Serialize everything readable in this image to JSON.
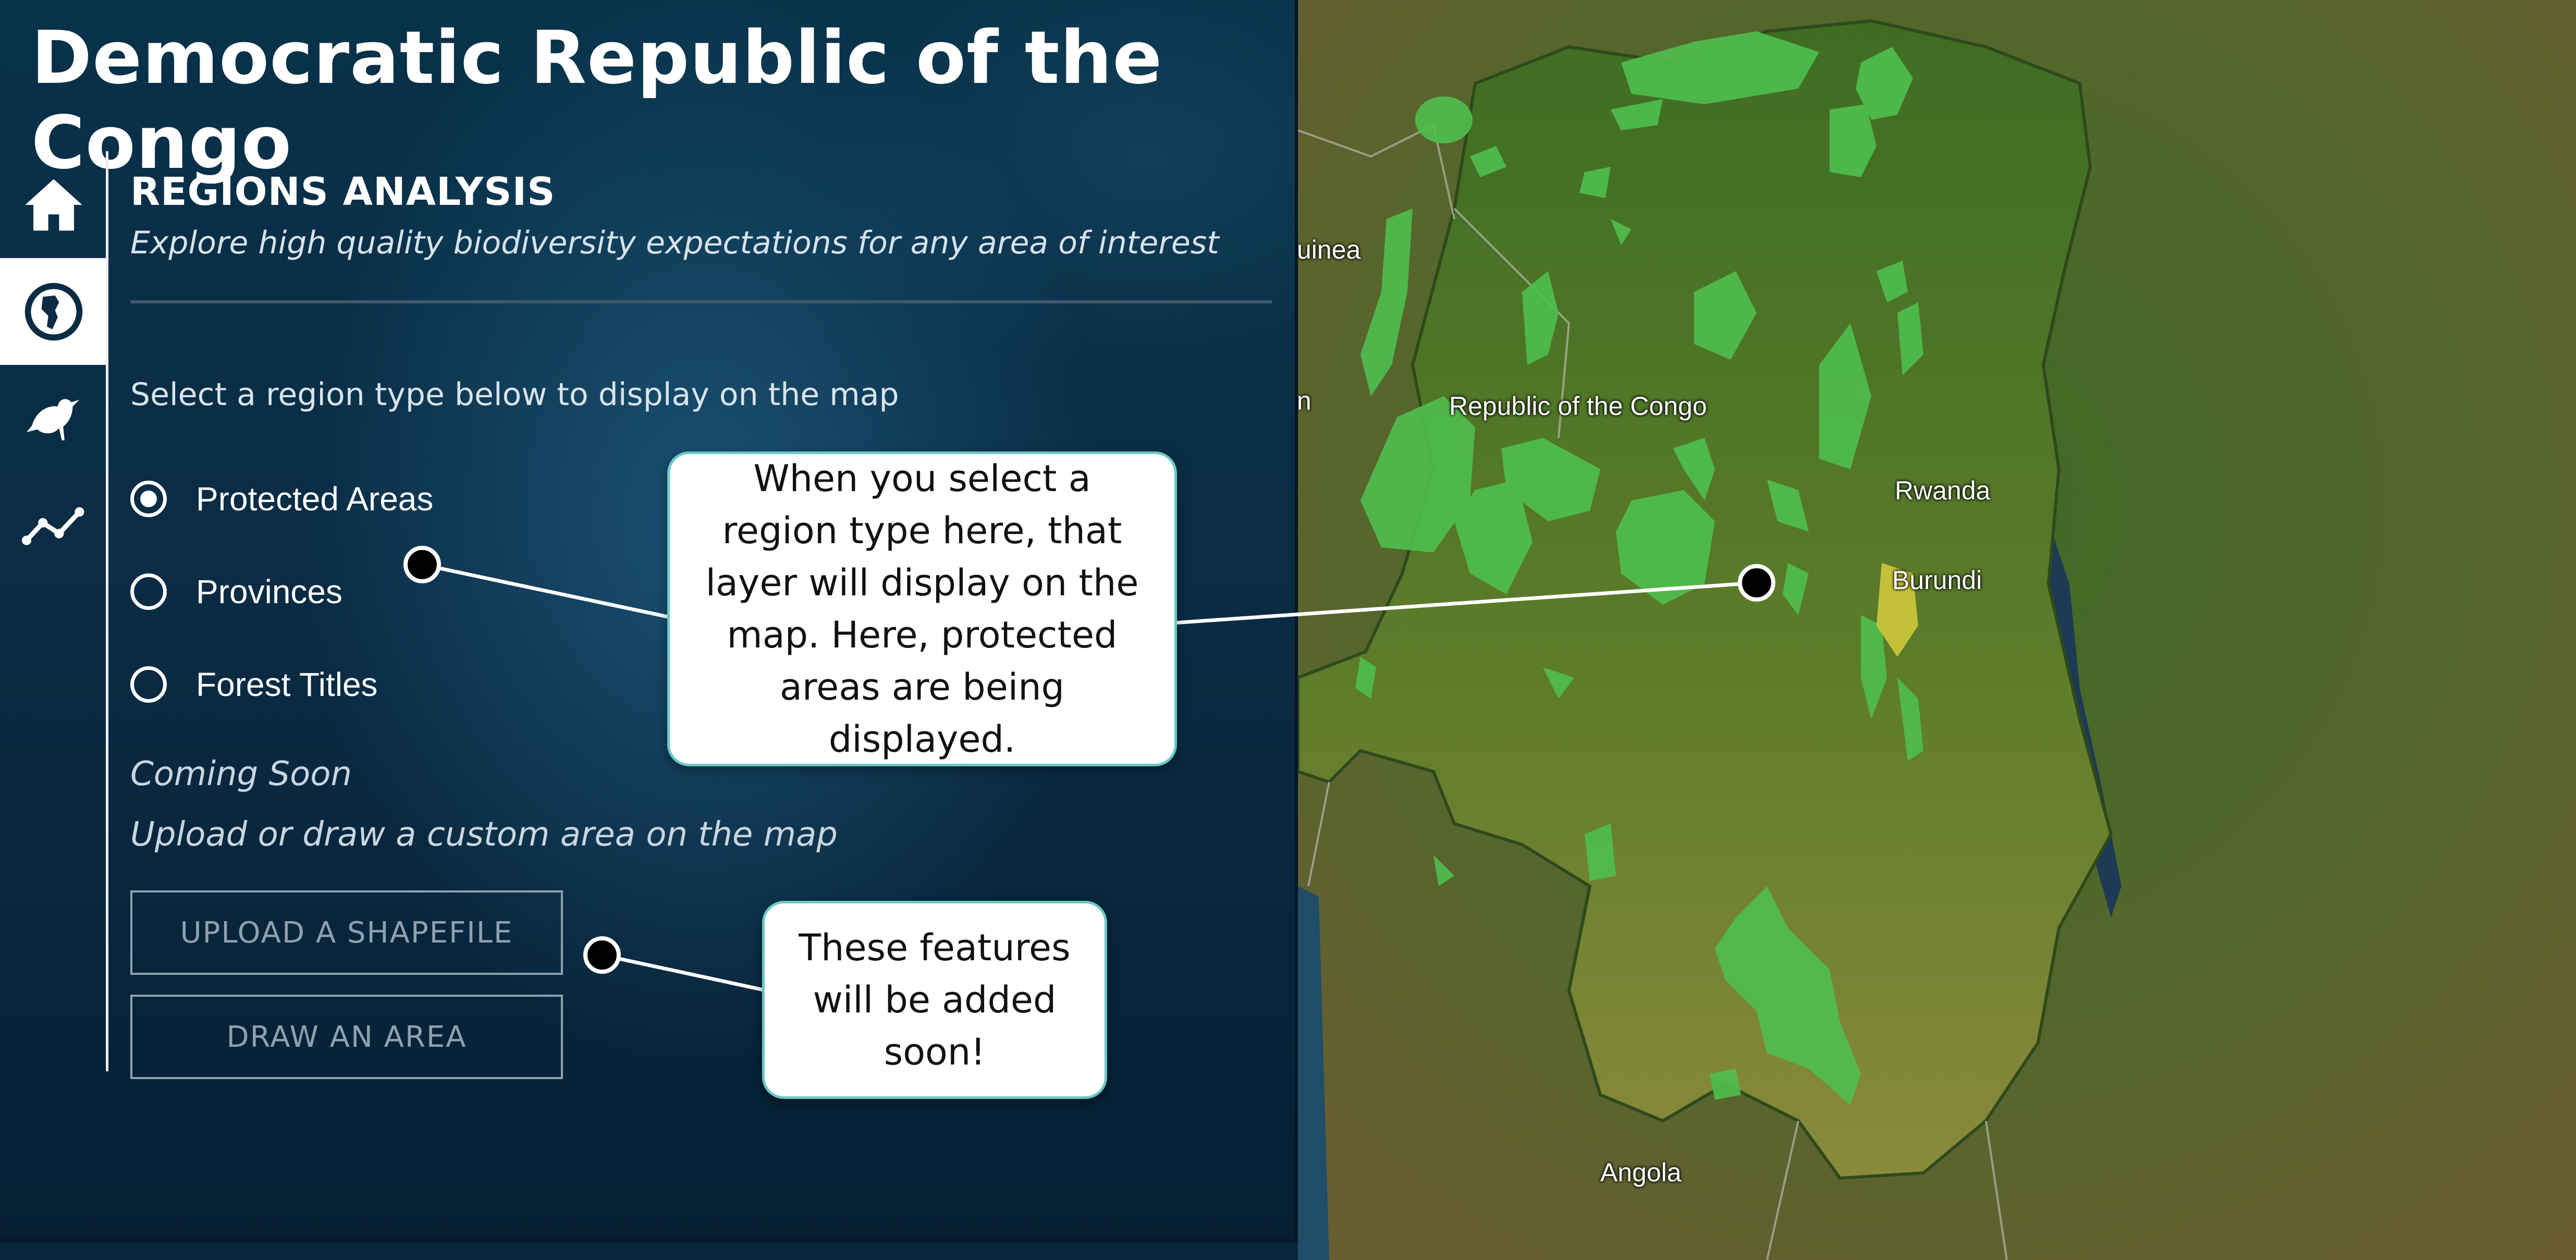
{
  "app": {
    "title": "Democratic Republic of the Congo"
  },
  "sidebar": {
    "items": [
      {
        "icon": "home-icon",
        "active": false
      },
      {
        "icon": "globe-region-icon",
        "active": true
      },
      {
        "icon": "bird-icon",
        "active": false
      },
      {
        "icon": "trend-line-icon",
        "active": false
      }
    ]
  },
  "regions": {
    "title": "REGIONS ANALYSIS",
    "subtitle": "Explore high quality biodiversity expectations for any area of interest",
    "instruction": "Select a region type below to display on the map",
    "options": [
      {
        "label": "Protected Areas",
        "selected": true
      },
      {
        "label": "Provinces",
        "selected": false
      },
      {
        "label": "Forest Titles",
        "selected": false
      }
    ],
    "coming_soon": "Coming Soon",
    "custom_area": "Upload or draw a custom area on the map",
    "upload_label": "UPLOAD A SHAPEFILE",
    "draw_label": "DRAW AN AREA"
  },
  "map": {
    "labels": {
      "guinea": "uinea",
      "n": "n",
      "rep_congo": "Republic of the Congo",
      "rwanda": "Rwanda",
      "burundi": "Burundi",
      "angola": "Angola"
    },
    "colors": {
      "protected_area": "#4fbf4f",
      "highlight_area": "#c9c53a",
      "country_fill": "#4e7a2c"
    }
  },
  "callouts": {
    "region_type": "When you select a region type here, that layer will display on the map. Here, protected areas are being displayed.",
    "coming_features": "These features will be added soon!"
  }
}
